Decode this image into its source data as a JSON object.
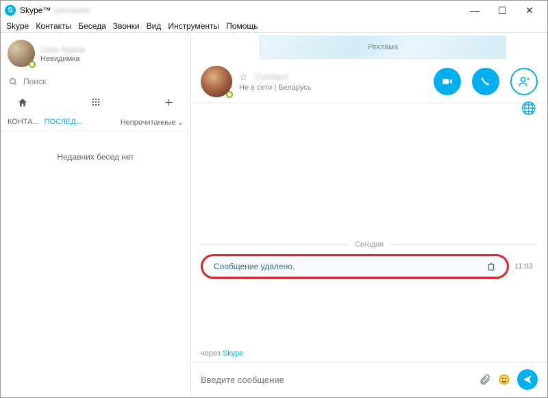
{
  "window": {
    "app_title": "Skype™"
  },
  "menu": [
    "Skype",
    "Контакты",
    "Беседа",
    "Звонки",
    "Вид",
    "Инструменты",
    "Помощь"
  ],
  "profile": {
    "status": "Невидимка"
  },
  "search": {
    "placeholder": "Поиск"
  },
  "tabs": {
    "contacts": "КОНТА...",
    "recent": "ПОСЛЕД...",
    "unread": "Непрочитанные"
  },
  "sidebar_empty": "Недавних бесед нет",
  "ad": "Реклама",
  "contact": {
    "status_line": "Не в сети  |  Беларусь"
  },
  "chat": {
    "day": "Сегодня",
    "deleted": "Сообщение удалено.",
    "time": "11:03",
    "via_prefix": "через ",
    "via_link": "Skype"
  },
  "composer": {
    "placeholder": "Введите сообщение"
  }
}
